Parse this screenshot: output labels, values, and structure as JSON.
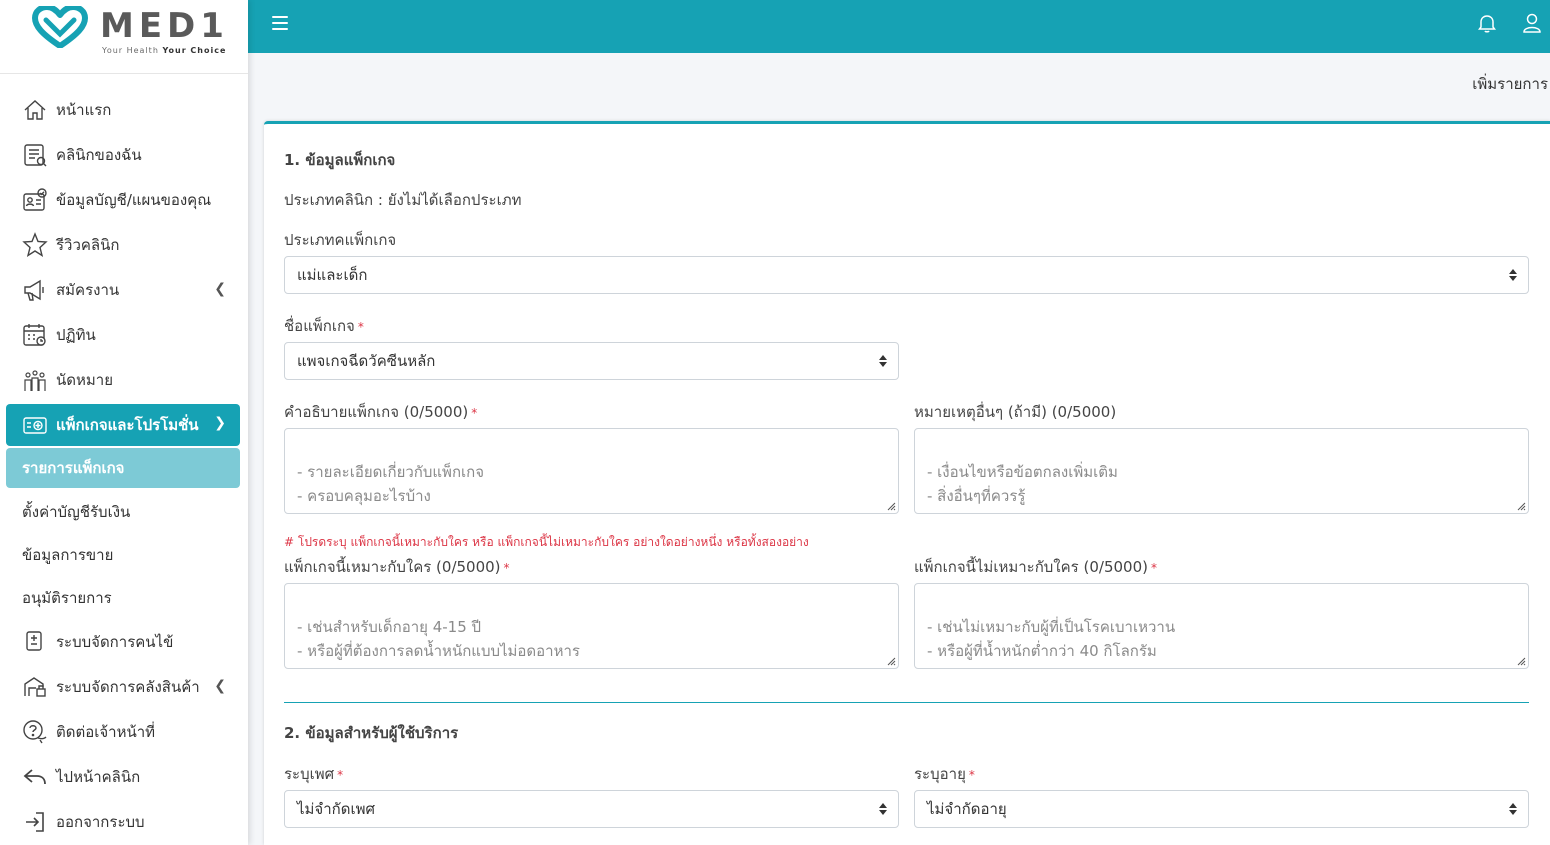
{
  "brand": {
    "name": "MED1",
    "tagline_a": "Your Health",
    "tagline_b": "Your Choice"
  },
  "sidebar": {
    "items": [
      {
        "label": "หน้าแรก",
        "icon": "home-icon"
      },
      {
        "label": "คลินิกของฉัน",
        "icon": "clinic-list-icon"
      },
      {
        "label": "ข้อมูลบัญชี/แผนของคุณ",
        "icon": "account-card-icon"
      },
      {
        "label": "รีวิวคลินิก",
        "icon": "star-icon"
      },
      {
        "label": "สมัครงาน",
        "icon": "megaphone-icon"
      },
      {
        "label": "ปฏิทิน",
        "icon": "calendar-icon"
      },
      {
        "label": "นัดหมาย",
        "icon": "appointment-icon"
      }
    ],
    "active": {
      "label": "แพ็กเกจและโปรโมชั่น",
      "icon": "package-icon"
    },
    "sub_active": "รายการแพ็กเกจ",
    "plain": [
      "ตั้งค่าบัญชีรับเงิน",
      "ข้อมูลการขาย",
      "อนุมัติรายการ"
    ],
    "bottom": [
      {
        "label": "ระบบจัดการคนไข้",
        "icon": "patient-list-icon"
      },
      {
        "label": "ระบบจัดการคลังสินค้า",
        "icon": "warehouse-icon"
      },
      {
        "label": "ติดต่อเจ้าหน้าที่",
        "icon": "support-icon"
      },
      {
        "label": "ไปหน้าคลินิก",
        "icon": "back-arrow-icon"
      },
      {
        "label": "ออกจากระบบ",
        "icon": "logout-icon"
      }
    ]
  },
  "topbar": {
    "menu_icon": "hamburger-icon",
    "bell_icon": "bell-icon",
    "user_icon": "user-icon"
  },
  "page": {
    "heading": "เพิ่มรายการ"
  },
  "form": {
    "section1_title": "1. ข้อมูลแพ็กเกจ",
    "clinic_type": "ประเภทคลินิก : ยังไม่ได้เลือกประเภท",
    "package_type_label": "ประเภทคแพ็กเกจ",
    "package_type_value": "แม่และเด็ก",
    "package_name_label": "ชื่อแพ็กเกจ",
    "package_name_value": "แพจเกจฉีดวัคซีนหลัก",
    "desc_label": "คำอธิบายแพ็กเกจ (0/5000)",
    "desc_placeholder": "- รายละเอียดเกี่ยวกับแพ็กเกจ\n- ครอบคลุมอะไรบ้าง",
    "remark_label": "หมายเหตุอื่นๆ (ถ้ามี) (0/5000)",
    "remark_placeholder": "- เงื่อนไขหรือข้อตกลงเพิ่มเติม\n- สิ่งอื่นๆที่ควรรู้",
    "note": "# โปรดระบุ แพ็กเกจนี้เหมาะกับใคร หรือ แพ็กเกจนี้ไม่เหมาะกับใคร อย่างใดอย่างหนึ่ง หรือทั้งสองอย่าง",
    "suit_label": "แพ็กเกจนี้เหมาะกับใคร (0/5000)",
    "suit_placeholder": "- เช่นสำหรับเด็กอายุ 4-15 ปี\n- หรือผู้ที่ต้องการลดน้ำหนักแบบไม่อดอาหาร",
    "unsuit_label": "แพ็กเกจนี้ไม่เหมาะกับใคร (0/5000)",
    "unsuit_placeholder": "- เช่นไม่เหมาะกับผู้ที่เป็นโรคเบาเหวาน\n- หรือผู้ที่น้ำหนักต่ำกว่า 40 กิโลกรัม",
    "section2_title": "2. ข้อมูลสำหรับผู้ใช้บริการ",
    "gender_label": "ระบุเพศ",
    "gender_value": "ไม่จำกัดเพศ",
    "age_label": "ระบุอายุ",
    "age_value": "ไม่จำกัดอายุ",
    "required_mark": "*"
  },
  "colors": {
    "accent": "#16a2b4",
    "accent_light": "#7dcad6",
    "required": "#dc3545"
  }
}
